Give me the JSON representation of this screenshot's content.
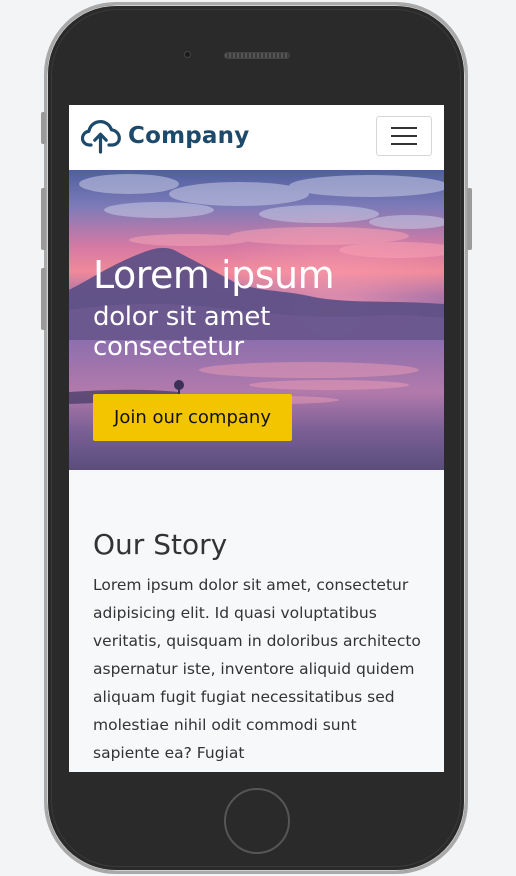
{
  "navbar": {
    "brand_name": "Company",
    "brand_icon": "cloud-upload-icon",
    "menu_icon": "hamburger-menu-icon"
  },
  "hero": {
    "title": "Lorem ipsum",
    "subtitle": "dolor sit amet consectetur",
    "cta_label": "Join our company"
  },
  "story": {
    "title": "Our Story",
    "body": "Lorem ipsum dolor sit amet, consectetur adipisicing elit. Id quasi voluptatibus veritatis, quisquam in doloribus architecto aspernatur iste, inventore aliquid quidem aliquam fugit fugiat necessitatibus sed molestiae nihil odit commodi sunt sapiente ea? Fugiat"
  },
  "colors": {
    "brand": "#1d4a6b",
    "accent": "#f2c500",
    "phone_body": "#2a2a2a",
    "page_bg": "#f7f8fa"
  }
}
